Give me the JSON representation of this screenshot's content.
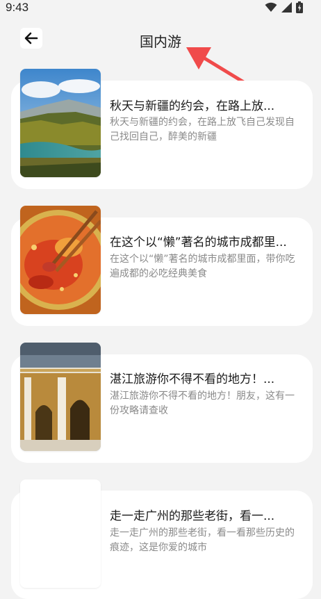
{
  "status": {
    "time": "9:43"
  },
  "header": {
    "title": "国内游",
    "back_icon": "arrow-left-icon"
  },
  "articles": [
    {
      "title": "秋天与新疆的约会，在路上放...",
      "desc": "秋天与新疆的约会，在路上放飞自己发现自己找回自己，醉美的新疆"
    },
    {
      "title": "在这个以“懒”著名的城市成都里...",
      "desc": "在这个以“懒”著名的城市成都里面，带你吃遍成都的必吃经典美食"
    },
    {
      "title": "湛江旅游你不得不看的地方！...",
      "desc": "湛江旅游你不得不看的地方！朋友，这有一份攻略请查收"
    },
    {
      "title": "走一走广州的那些老街，看一...",
      "desc": "走一走广州的那些老街，看一看那些历史的痕迹，这是你爱的城市"
    }
  ],
  "colors": {
    "background": "#f3f3f3",
    "card": "#ffffff",
    "annotation": "#f04b4b"
  }
}
